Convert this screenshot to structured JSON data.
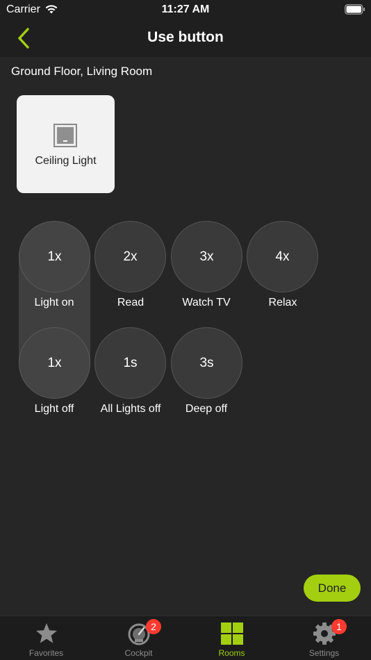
{
  "status_bar": {
    "carrier": "Carrier",
    "time": "11:27 AM"
  },
  "nav": {
    "title": "Use button"
  },
  "location": "Ground Floor, Living Room",
  "device": {
    "label": "Ceiling Light"
  },
  "actions": [
    {
      "press": "1x",
      "label": "Light on",
      "active": true
    },
    {
      "press": "2x",
      "label": "Read",
      "active": false
    },
    {
      "press": "3x",
      "label": "Watch TV",
      "active": false
    },
    {
      "press": "4x",
      "label": "Relax",
      "active": false
    },
    {
      "press": "1x",
      "label": "Light off",
      "active": true
    },
    {
      "press": "1s",
      "label": "All Lights off",
      "active": false
    },
    {
      "press": "3s",
      "label": "Deep off",
      "active": false
    }
  ],
  "done_label": "Done",
  "tabs": [
    {
      "label": "Favorites",
      "icon": "star-icon",
      "active": false,
      "badge": ""
    },
    {
      "label": "Cockpit",
      "icon": "gauge-icon",
      "active": false,
      "badge": "2"
    },
    {
      "label": "Rooms",
      "icon": "grid-icon",
      "active": true,
      "badge": ""
    },
    {
      "label": "Settings",
      "icon": "gear-icon",
      "active": false,
      "badge": "1"
    }
  ],
  "colors": {
    "accent": "#a4cf10",
    "background": "#262626",
    "badge": "#ff3b30"
  }
}
